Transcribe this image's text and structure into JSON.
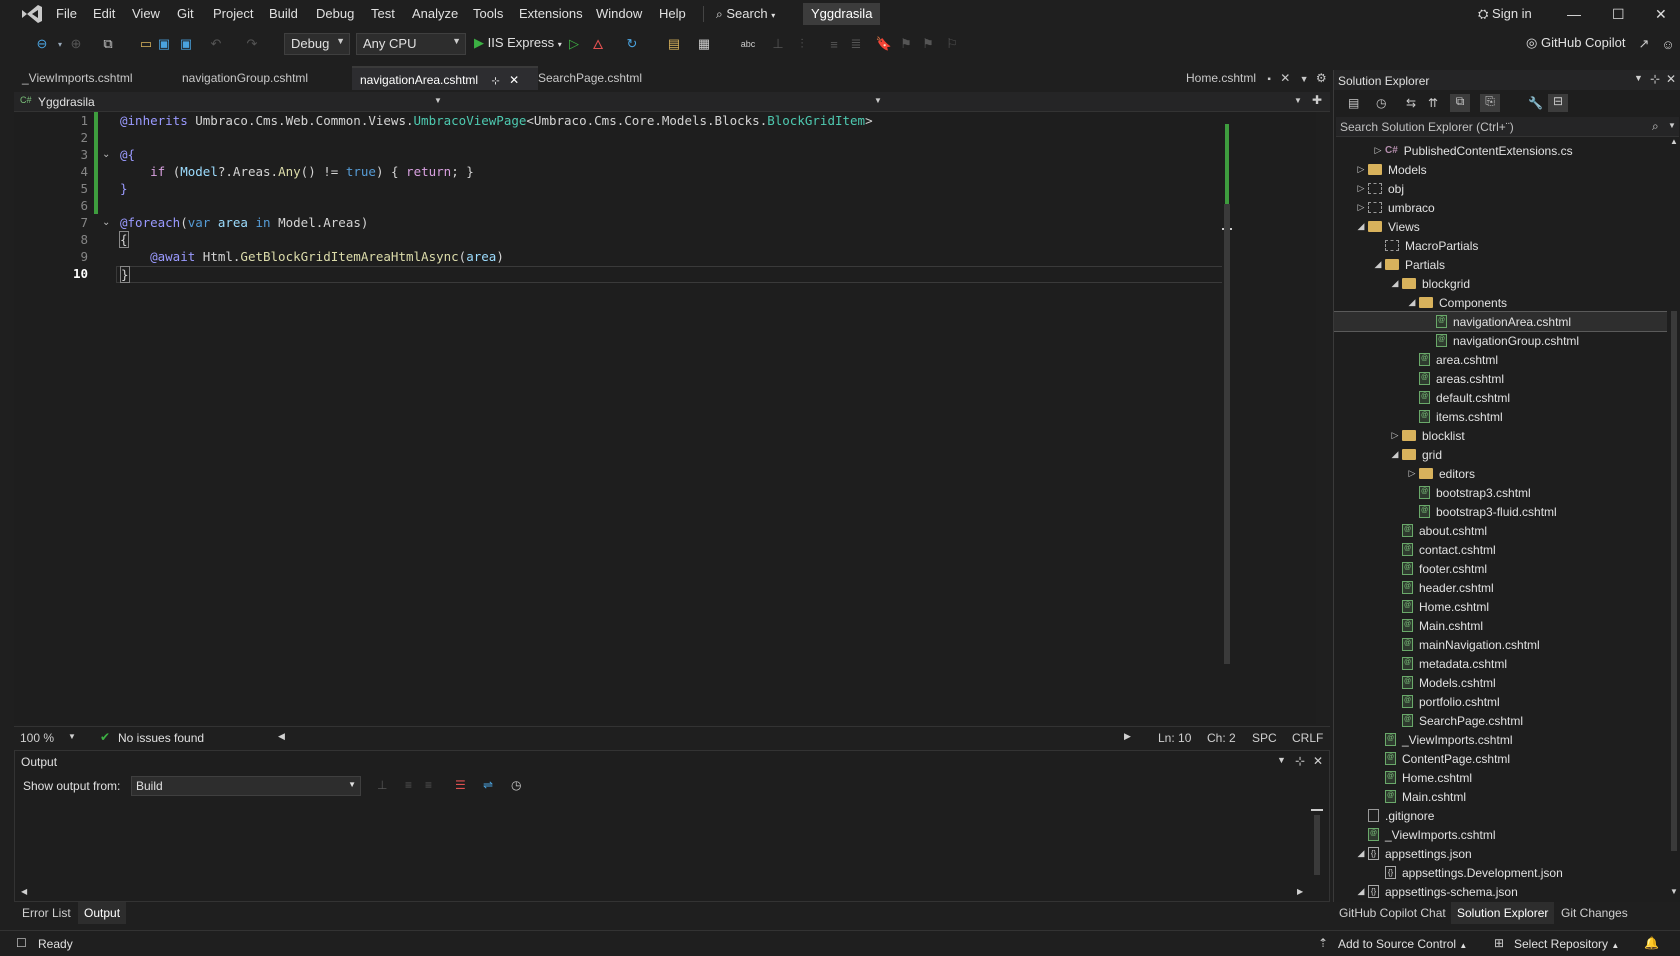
{
  "menubar": {
    "items": [
      "File",
      "Edit",
      "View",
      "Git",
      "Project",
      "Build",
      "Debug",
      "Test",
      "Analyze",
      "Tools",
      "Extensions",
      "Window",
      "Help"
    ],
    "search_label": "Search",
    "solution_name": "Yggdrasila",
    "sign_in": "Sign in"
  },
  "toolbar": {
    "config": "Debug",
    "platform": "Any CPU",
    "run_target": "IIS Express",
    "copilot": "GitHub Copilot"
  },
  "doc_tabs": [
    {
      "label": "_ViewImports.cshtml",
      "active": false
    },
    {
      "label": "navigationGroup.cshtml",
      "active": false
    },
    {
      "label": "navigationArea.cshtml",
      "active": true
    },
    {
      "label": "SearchPage.cshtml",
      "active": false
    }
  ],
  "overflow_tab": "Home.cshtml",
  "nav_project": "Yggdrasila",
  "editor": {
    "line_numbers": [
      "1",
      "2",
      "3",
      "4",
      "5",
      "6",
      "7",
      "8",
      "9",
      "10"
    ],
    "current_line": "10"
  },
  "editor_status": {
    "zoom": "100 %",
    "issues": "No issues found",
    "ln": "Ln: 10",
    "ch": "Ch: 2",
    "spc": "SPC",
    "eol": "CRLF"
  },
  "output": {
    "title": "Output",
    "show_from_label": "Show output from:",
    "source": "Build"
  },
  "bottom_tabs": [
    "Error List",
    "Output"
  ],
  "solution_explorer": {
    "title": "Solution Explorer",
    "search_placeholder": "Search Solution Explorer (Ctrl+¨)",
    "tabs": [
      "GitHub Copilot Chat",
      "Solution Explorer",
      "Git Changes"
    ],
    "tree": [
      {
        "label": "PublishedContentExtensions.cs",
        "indent": 3,
        "icon": "cs",
        "exp": "closed"
      },
      {
        "label": "Models",
        "indent": 2,
        "icon": "folder",
        "exp": "closed"
      },
      {
        "label": "obj",
        "indent": 2,
        "icon": "folder-dim",
        "exp": "closed"
      },
      {
        "label": "umbraco",
        "indent": 2,
        "icon": "folder-dim",
        "exp": "closed"
      },
      {
        "label": "Views",
        "indent": 2,
        "icon": "folder",
        "exp": "open"
      },
      {
        "label": "MacroPartials",
        "indent": 3,
        "icon": "folder-dim",
        "exp": "none"
      },
      {
        "label": "Partials",
        "indent": 3,
        "icon": "folder",
        "exp": "open"
      },
      {
        "label": "blockgrid",
        "indent": 4,
        "icon": "folder",
        "exp": "open"
      },
      {
        "label": "Components",
        "indent": 5,
        "icon": "folder",
        "exp": "open"
      },
      {
        "label": "navigationArea.cshtml",
        "indent": 6,
        "icon": "file",
        "exp": "none",
        "selected": true
      },
      {
        "label": "navigationGroup.cshtml",
        "indent": 6,
        "icon": "file",
        "exp": "none"
      },
      {
        "label": "area.cshtml",
        "indent": 5,
        "icon": "file",
        "exp": "none"
      },
      {
        "label": "areas.cshtml",
        "indent": 5,
        "icon": "file",
        "exp": "none"
      },
      {
        "label": "default.cshtml",
        "indent": 5,
        "icon": "file",
        "exp": "none"
      },
      {
        "label": "items.cshtml",
        "indent": 5,
        "icon": "file",
        "exp": "none"
      },
      {
        "label": "blocklist",
        "indent": 4,
        "icon": "folder",
        "exp": "closed"
      },
      {
        "label": "grid",
        "indent": 4,
        "icon": "folder",
        "exp": "open"
      },
      {
        "label": "editors",
        "indent": 5,
        "icon": "folder",
        "exp": "closed"
      },
      {
        "label": "bootstrap3.cshtml",
        "indent": 5,
        "icon": "file",
        "exp": "none"
      },
      {
        "label": "bootstrap3-fluid.cshtml",
        "indent": 5,
        "icon": "file",
        "exp": "none"
      },
      {
        "label": "about.cshtml",
        "indent": 4,
        "icon": "file",
        "exp": "none"
      },
      {
        "label": "contact.cshtml",
        "indent": 4,
        "icon": "file",
        "exp": "none"
      },
      {
        "label": "footer.cshtml",
        "indent": 4,
        "icon": "file",
        "exp": "none"
      },
      {
        "label": "header.cshtml",
        "indent": 4,
        "icon": "file",
        "exp": "none"
      },
      {
        "label": "Home.cshtml",
        "indent": 4,
        "icon": "file",
        "exp": "none"
      },
      {
        "label": "Main.cshtml",
        "indent": 4,
        "icon": "file",
        "exp": "none"
      },
      {
        "label": "mainNavigation.cshtml",
        "indent": 4,
        "icon": "file",
        "exp": "none"
      },
      {
        "label": "metadata.cshtml",
        "indent": 4,
        "icon": "file",
        "exp": "none"
      },
      {
        "label": "Models.cshtml",
        "indent": 4,
        "icon": "file",
        "exp": "none"
      },
      {
        "label": "portfolio.cshtml",
        "indent": 4,
        "icon": "file",
        "exp": "none"
      },
      {
        "label": "SearchPage.cshtml",
        "indent": 4,
        "icon": "file",
        "exp": "none"
      },
      {
        "label": "_ViewImports.cshtml",
        "indent": 3,
        "icon": "file",
        "exp": "none"
      },
      {
        "label": "ContentPage.cshtml",
        "indent": 3,
        "icon": "file",
        "exp": "none"
      },
      {
        "label": "Home.cshtml",
        "indent": 3,
        "icon": "file",
        "exp": "none"
      },
      {
        "label": "Main.cshtml",
        "indent": 3,
        "icon": "file",
        "exp": "none"
      },
      {
        "label": ".gitignore",
        "indent": 2,
        "icon": "plain",
        "exp": "none"
      },
      {
        "label": "_ViewImports.cshtml",
        "indent": 2,
        "icon": "file",
        "exp": "none"
      },
      {
        "label": "appsettings.json",
        "indent": 2,
        "icon": "json",
        "exp": "open"
      },
      {
        "label": "appsettings.Development.json",
        "indent": 3,
        "icon": "json",
        "exp": "none"
      },
      {
        "label": "appsettings-schema.json",
        "indent": 2,
        "icon": "json",
        "exp": "open"
      }
    ]
  },
  "statusbar": {
    "ready": "Ready",
    "source_control": "Add to Source Control",
    "repository": "Select Repository"
  }
}
